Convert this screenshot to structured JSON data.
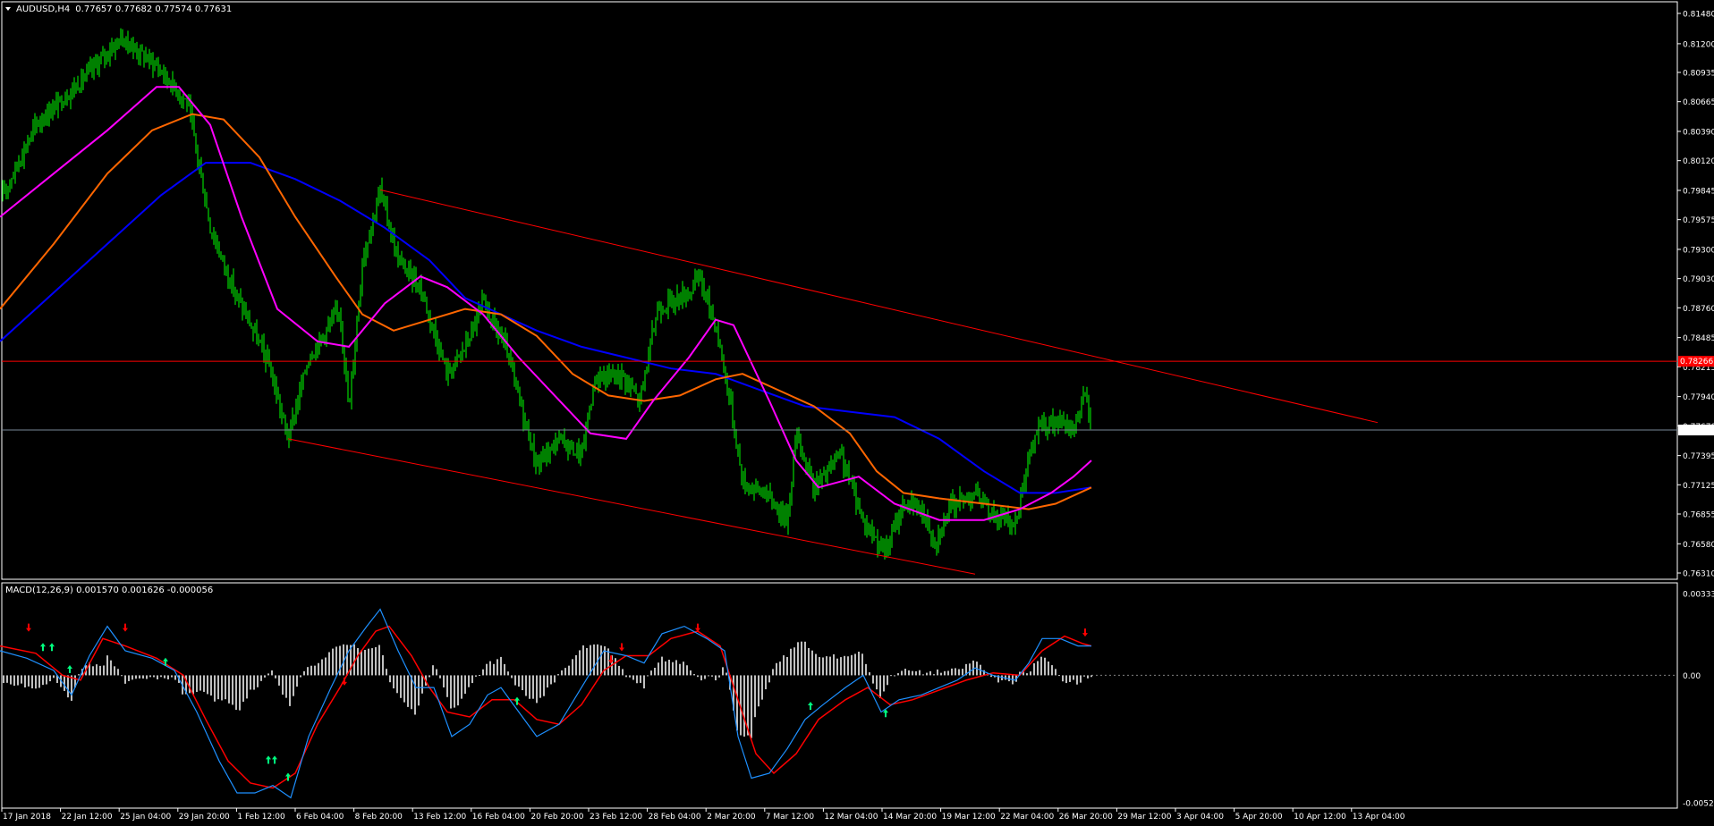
{
  "main_chart": {
    "symbol_timeframe": "AUDUSD,H4",
    "quote": "0.77657 0.77682 0.77574 0.77631",
    "price_labels": [
      "0.81480",
      "0.81200",
      "0.80935",
      "0.80665",
      "0.80390",
      "0.80120",
      "0.79845",
      "0.79575",
      "0.79300",
      "0.79030",
      "0.78760",
      "0.78485",
      "0.78215",
      "0.77940",
      "0.77670",
      "0.77395",
      "0.77125",
      "0.76855",
      "0.76580",
      "0.76310"
    ],
    "current_price_label": "0.77631",
    "horizontal_level_label": "0.78266",
    "colors": {
      "background": "#000000",
      "frame": "#ffffff",
      "candle": "#00ff00",
      "ma_fast": "#ff00ff",
      "ma_mid": "#ff6600",
      "ma_slow": "#0000ff",
      "trendline": "#ff0000",
      "bid_line": "#778899",
      "level_line": "#ff0000"
    }
  },
  "macd": {
    "header": "MACD(12,26,9) 0.001570 0.001626 -0.000056",
    "scale_labels": [
      "0.003337",
      "0.00",
      "-0.005203"
    ],
    "colors": {
      "histogram": "#c0c0c0",
      "main_line": "#1e90ff",
      "signal_line": "#ff0000",
      "up_arrow": "#00ff7f",
      "down_arrow": "#ff0000"
    }
  },
  "time_labels": [
    "17 Jan 2018",
    "22 Jan 12:00",
    "25 Jan 04:00",
    "29 Jan 20:00",
    "1 Feb 12:00",
    "6 Feb 04:00",
    "8 Feb 20:00",
    "13 Feb 12:00",
    "16 Feb 04:00",
    "20 Feb 20:00",
    "23 Feb 12:00",
    "28 Feb 04:00",
    "2 Mar 20:00",
    "7 Mar 12:00",
    "12 Mar 04:00",
    "14 Mar 20:00",
    "19 Mar 12:00",
    "22 Mar 04:00",
    "26 Mar 20:00",
    "29 Mar 12:00",
    "3 Apr 04:00",
    "5 Apr 20:00",
    "10 Apr 12:00",
    "13 Apr 04:00"
  ],
  "chart_data": {
    "type": "candlestick",
    "title": "AUDUSD,H4",
    "y_range": [
      0.7631,
      0.8148
    ],
    "price_anchors": [
      [
        0,
        0.7975
      ],
      [
        40,
        0.8045
      ],
      [
        90,
        0.8085
      ],
      [
        135,
        0.8125
      ],
      [
        175,
        0.81
      ],
      [
        210,
        0.8065
      ],
      [
        235,
        0.795
      ],
      [
        260,
        0.7895
      ],
      [
        300,
        0.7825
      ],
      [
        322,
        0.7755
      ],
      [
        345,
        0.783
      ],
      [
        380,
        0.7875
      ],
      [
        390,
        0.778
      ],
      [
        405,
        0.792
      ],
      [
        425,
        0.7985
      ],
      [
        445,
        0.792
      ],
      [
        470,
        0.7895
      ],
      [
        500,
        0.7815
      ],
      [
        520,
        0.784
      ],
      [
        540,
        0.788
      ],
      [
        565,
        0.784
      ],
      [
        600,
        0.773
      ],
      [
        625,
        0.7755
      ],
      [
        650,
        0.774
      ],
      [
        665,
        0.781
      ],
      [
        695,
        0.7815
      ],
      [
        715,
        0.779
      ],
      [
        735,
        0.7875
      ],
      [
        770,
        0.789
      ],
      [
        782,
        0.7905
      ],
      [
        800,
        0.786
      ],
      [
        815,
        0.7795
      ],
      [
        830,
        0.7715
      ],
      [
        855,
        0.7705
      ],
      [
        880,
        0.768
      ],
      [
        890,
        0.776
      ],
      [
        910,
        0.771
      ],
      [
        940,
        0.774
      ],
      [
        965,
        0.768
      ],
      [
        990,
        0.765
      ],
      [
        1010,
        0.7695
      ],
      [
        1030,
        0.769
      ],
      [
        1045,
        0.766
      ],
      [
        1065,
        0.7695
      ],
      [
        1090,
        0.7705
      ],
      [
        1110,
        0.7685
      ],
      [
        1135,
        0.7675
      ],
      [
        1145,
        0.772
      ],
      [
        1160,
        0.7765
      ],
      [
        1180,
        0.777
      ],
      [
        1200,
        0.7765
      ],
      [
        1213,
        0.7795
      ],
      [
        1220,
        0.7765
      ]
    ],
    "ma_fast": [
      [
        0,
        0.796
      ],
      [
        60,
        0.8
      ],
      [
        120,
        0.804
      ],
      [
        175,
        0.808
      ],
      [
        200,
        0.808
      ],
      [
        235,
        0.8045
      ],
      [
        270,
        0.796
      ],
      [
        310,
        0.7875
      ],
      [
        355,
        0.7845
      ],
      [
        390,
        0.784
      ],
      [
        430,
        0.788
      ],
      [
        470,
        0.7905
      ],
      [
        500,
        0.7895
      ],
      [
        540,
        0.787
      ],
      [
        580,
        0.783
      ],
      [
        620,
        0.7795
      ],
      [
        660,
        0.776
      ],
      [
        700,
        0.7755
      ],
      [
        730,
        0.779
      ],
      [
        770,
        0.783
      ],
      [
        800,
        0.7865
      ],
      [
        820,
        0.786
      ],
      [
        860,
        0.779
      ],
      [
        890,
        0.7735
      ],
      [
        915,
        0.771
      ],
      [
        960,
        0.772
      ],
      [
        1000,
        0.7695
      ],
      [
        1050,
        0.768
      ],
      [
        1100,
        0.768
      ],
      [
        1140,
        0.769
      ],
      [
        1175,
        0.7705
      ],
      [
        1200,
        0.772
      ],
      [
        1220,
        0.7735
      ]
    ],
    "ma_mid": [
      [
        0,
        0.7875
      ],
      [
        60,
        0.7935
      ],
      [
        120,
        0.8
      ],
      [
        170,
        0.804
      ],
      [
        215,
        0.8055
      ],
      [
        250,
        0.805
      ],
      [
        290,
        0.8015
      ],
      [
        330,
        0.796
      ],
      [
        375,
        0.7905
      ],
      [
        405,
        0.787
      ],
      [
        440,
        0.7855
      ],
      [
        480,
        0.7865
      ],
      [
        520,
        0.7875
      ],
      [
        560,
        0.787
      ],
      [
        600,
        0.785
      ],
      [
        640,
        0.7815
      ],
      [
        680,
        0.7795
      ],
      [
        720,
        0.779
      ],
      [
        760,
        0.7795
      ],
      [
        800,
        0.781
      ],
      [
        830,
        0.7815
      ],
      [
        870,
        0.78
      ],
      [
        910,
        0.7785
      ],
      [
        950,
        0.776
      ],
      [
        980,
        0.7725
      ],
      [
        1010,
        0.7705
      ],
      [
        1050,
        0.77
      ],
      [
        1100,
        0.7695
      ],
      [
        1150,
        0.769
      ],
      [
        1180,
        0.7695
      ],
      [
        1220,
        0.771
      ]
    ],
    "ma_slow": [
      [
        0,
        0.7845
      ],
      [
        60,
        0.789
      ],
      [
        120,
        0.7935
      ],
      [
        180,
        0.798
      ],
      [
        230,
        0.801
      ],
      [
        280,
        0.801
      ],
      [
        330,
        0.7995
      ],
      [
        380,
        0.7975
      ],
      [
        430,
        0.795
      ],
      [
        480,
        0.792
      ],
      [
        520,
        0.7885
      ],
      [
        560,
        0.787
      ],
      [
        600,
        0.7855
      ],
      [
        650,
        0.784
      ],
      [
        700,
        0.783
      ],
      [
        750,
        0.782
      ],
      [
        800,
        0.7815
      ],
      [
        850,
        0.78
      ],
      [
        900,
        0.7785
      ],
      [
        950,
        0.778
      ],
      [
        1000,
        0.7775
      ],
      [
        1050,
        0.7755
      ],
      [
        1100,
        0.7725
      ],
      [
        1140,
        0.7705
      ],
      [
        1180,
        0.7705
      ],
      [
        1220,
        0.771
      ]
    ],
    "trendlines": [
      {
        "from": [
          425,
          0.7985
        ],
        "to": [
          1540,
          0.777
        ]
      },
      {
        "from": [
          322,
          0.7755
        ],
        "to": [
          1090,
          0.763
        ]
      }
    ],
    "horizontal_level": 0.78266,
    "current_price": 0.77631,
    "macd_range": [
      -0.005203,
      0.003337
    ],
    "macd_main": [
      [
        0,
        0.001
      ],
      [
        30,
        0.0007
      ],
      [
        60,
        0.0002
      ],
      [
        80,
        -0.0008
      ],
      [
        100,
        0.0008
      ],
      [
        120,
        0.002
      ],
      [
        140,
        0.001
      ],
      [
        170,
        0.0007
      ],
      [
        195,
        0.0002
      ],
      [
        220,
        -0.0015
      ],
      [
        245,
        -0.0035
      ],
      [
        265,
        -0.0048
      ],
      [
        285,
        -0.0048
      ],
      [
        305,
        -0.0045
      ],
      [
        325,
        -0.005
      ],
      [
        345,
        -0.0025
      ],
      [
        370,
        -0.0005
      ],
      [
        390,
        0.001
      ],
      [
        410,
        0.002
      ],
      [
        425,
        0.0027
      ],
      [
        445,
        0.001
      ],
      [
        465,
        -0.0005
      ],
      [
        485,
        -0.0005
      ],
      [
        505,
        -0.0025
      ],
      [
        525,
        -0.002
      ],
      [
        545,
        -0.0008
      ],
      [
        560,
        -0.0005
      ],
      [
        580,
        -0.0015
      ],
      [
        600,
        -0.0025
      ],
      [
        625,
        -0.002
      ],
      [
        650,
        -0.0005
      ],
      [
        675,
        0.001
      ],
      [
        700,
        0.0008
      ],
      [
        720,
        0.0005
      ],
      [
        740,
        0.0017
      ],
      [
        765,
        0.002
      ],
      [
        790,
        0.0015
      ],
      [
        810,
        0.001
      ],
      [
        825,
        -0.0025
      ],
      [
        840,
        -0.0042
      ],
      [
        860,
        -0.004
      ],
      [
        880,
        -0.003
      ],
      [
        900,
        -0.0018
      ],
      [
        920,
        -0.0012
      ],
      [
        945,
        -0.0005
      ],
      [
        965,
        0.0
      ],
      [
        985,
        -0.0015
      ],
      [
        1005,
        -0.001
      ],
      [
        1030,
        -0.0008
      ],
      [
        1050,
        -0.0005
      ],
      [
        1070,
        -0.0002
      ],
      [
        1090,
        0.0003
      ],
      [
        1110,
        0.0
      ],
      [
        1135,
        -0.0002
      ],
      [
        1150,
        0.0005
      ],
      [
        1165,
        0.0015
      ],
      [
        1185,
        0.0015
      ],
      [
        1205,
        0.0012
      ],
      [
        1220,
        0.0012
      ]
    ],
    "macd_signal": [
      [
        0,
        0.0012
      ],
      [
        40,
        0.0009
      ],
      [
        70,
        0.0
      ],
      [
        90,
        -0.0002
      ],
      [
        115,
        0.0015
      ],
      [
        140,
        0.0012
      ],
      [
        175,
        0.0007
      ],
      [
        205,
        0.0
      ],
      [
        230,
        -0.0018
      ],
      [
        255,
        -0.0035
      ],
      [
        280,
        -0.0044
      ],
      [
        305,
        -0.0046
      ],
      [
        330,
        -0.004
      ],
      [
        355,
        -0.002
      ],
      [
        380,
        -0.0005
      ],
      [
        400,
        0.0008
      ],
      [
        420,
        0.0018
      ],
      [
        435,
        0.002
      ],
      [
        460,
        0.0008
      ],
      [
        480,
        -0.0005
      ],
      [
        500,
        -0.0015
      ],
      [
        525,
        -0.0017
      ],
      [
        550,
        -0.001
      ],
      [
        575,
        -0.001
      ],
      [
        600,
        -0.0018
      ],
      [
        625,
        -0.002
      ],
      [
        650,
        -0.0012
      ],
      [
        675,
        0.0002
      ],
      [
        700,
        0.0008
      ],
      [
        725,
        0.0008
      ],
      [
        750,
        0.0015
      ],
      [
        780,
        0.0018
      ],
      [
        805,
        0.0012
      ],
      [
        825,
        -0.001
      ],
      [
        845,
        -0.0032
      ],
      [
        865,
        -0.004
      ],
      [
        890,
        -0.0032
      ],
      [
        915,
        -0.0018
      ],
      [
        945,
        -0.001
      ],
      [
        970,
        -0.0005
      ],
      [
        995,
        -0.0012
      ],
      [
        1020,
        -0.001
      ],
      [
        1050,
        -0.0006
      ],
      [
        1080,
        -0.0002
      ],
      [
        1110,
        0.0001
      ],
      [
        1140,
        0.0
      ],
      [
        1165,
        0.001
      ],
      [
        1190,
        0.0016
      ],
      [
        1210,
        0.0013
      ],
      [
        1220,
        0.0012
      ]
    ],
    "arrows_up": [
      [
        48,
        0.0011
      ],
      [
        58,
        0.0011
      ],
      [
        78,
        0.0002
      ],
      [
        185,
        0.0005
      ],
      [
        300,
        -0.0035
      ],
      [
        307,
        -0.0035
      ],
      [
        322,
        -0.0042
      ],
      [
        578,
        -0.0011
      ],
      [
        906,
        -0.0013
      ],
      [
        990,
        -0.0016
      ]
    ],
    "arrows_down": [
      [
        32,
        0.002
      ],
      [
        140,
        0.002
      ],
      [
        385,
        -0.0002
      ],
      [
        683,
        0.0007
      ],
      [
        695,
        0.0012
      ],
      [
        780,
        0.002
      ],
      [
        1213,
        0.0018
      ]
    ]
  }
}
